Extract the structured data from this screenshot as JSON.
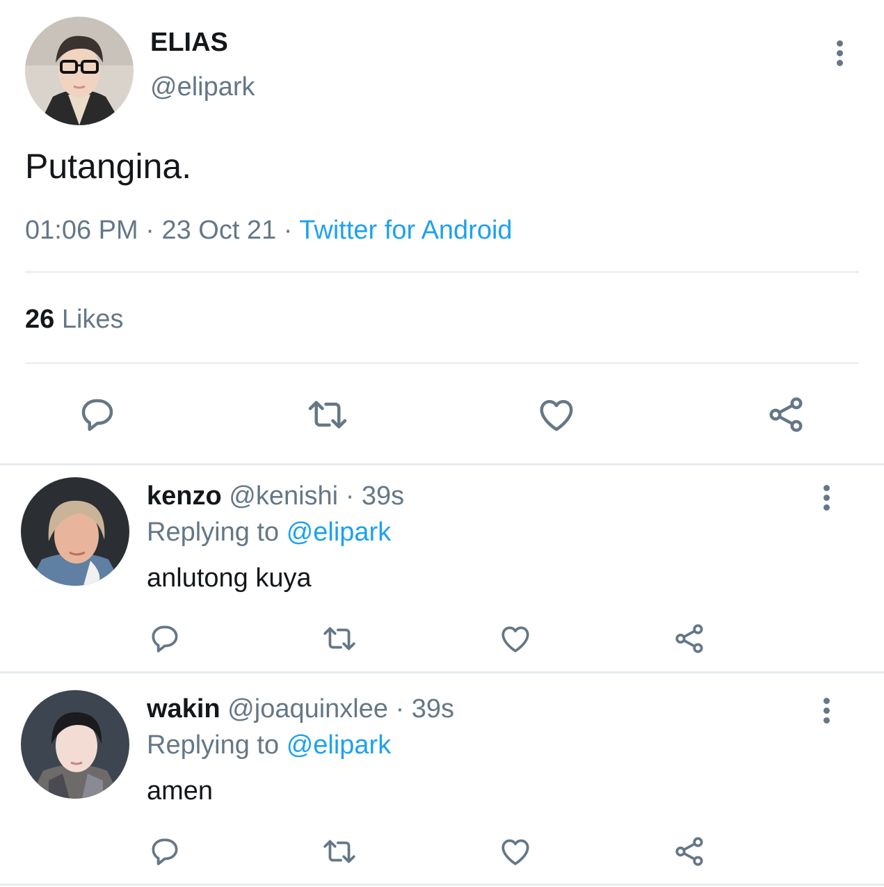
{
  "main_tweet": {
    "display_name": "ELIAS",
    "handle": "@elipark",
    "text": "Putangina.",
    "time": "01:06 PM",
    "date": "23 Oct 21",
    "source": "Twitter for Android",
    "separator": "·",
    "likes_count": "26",
    "likes_label": "Likes",
    "actions": [
      "reply-icon",
      "retweet-icon",
      "like-icon",
      "share-icon"
    ]
  },
  "replies": [
    {
      "display_name": "kenzo",
      "handle": "@kenishi",
      "time": "· 39s",
      "replying_prefix": "Replying to",
      "replying_to": "@elipark",
      "text": "anlutong kuya"
    },
    {
      "display_name": "wakin",
      "handle": "@joaquinxlee",
      "time": "· 39s",
      "replying_prefix": "Replying to",
      "replying_to": "@elipark",
      "text": "amen"
    }
  ],
  "colors": {
    "accent": "#1da1f2",
    "secondary_text": "#657786",
    "primary_text": "#14171a",
    "divider": "#e6ecf0"
  }
}
